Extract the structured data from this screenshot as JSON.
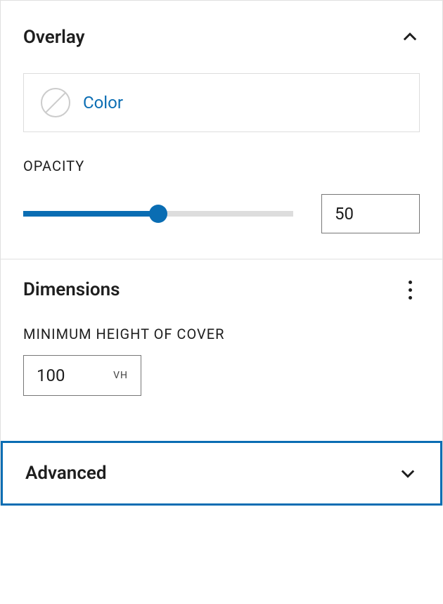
{
  "overlay": {
    "title": "Overlay",
    "expanded": true,
    "color": {
      "label": "Color"
    },
    "opacity": {
      "label": "OPACITY",
      "value": "50",
      "percent": 50
    }
  },
  "dimensions": {
    "title": "Dimensions",
    "minHeight": {
      "label": "MINIMUM HEIGHT OF COVER",
      "value": "100",
      "unit": "VH"
    }
  },
  "advanced": {
    "title": "Advanced",
    "expanded": false
  }
}
